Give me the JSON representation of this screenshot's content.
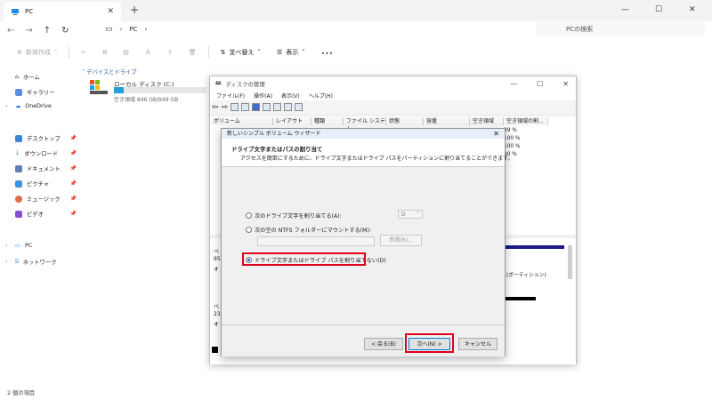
{
  "window": {
    "tab_title": "PC",
    "new_tab": "+",
    "minimize": "—",
    "maximize": "☐",
    "close": "✕"
  },
  "address": {
    "root": "PC",
    "placeholder": "PCの検索"
  },
  "toolbar": {
    "new_label": "新規作成",
    "sort_label": "並べ替え",
    "view_label": "表示",
    "more_label": "･･･"
  },
  "sidebar": {
    "home": "ホーム",
    "gallery": "ギャラリー",
    "onedrive": "OneDrive",
    "desktop": "デスクトップ",
    "downloads": "ダウンロード",
    "documents": "ドキュメント",
    "pictures": "ピクチャ",
    "music": "ミュージック",
    "videos": "ビデオ",
    "pc": "PC",
    "network": "ネットワーク"
  },
  "main": {
    "group": "デバイスとドライブ",
    "drive_name": "ローカル ディスク (C:)",
    "drive_free": "空き領域 846 GB/949 GB",
    "drive_used_fraction": 0.11
  },
  "status_bar": "2 個の項目",
  "disk_mgmt": {
    "title": "ディスクの管理",
    "menu": [
      "ファイル(F)",
      "操作(A)",
      "表示(V)",
      "ヘルプ(H)"
    ],
    "columns": [
      "ボリューム",
      "レイアウト",
      "種類",
      "ファイル システム",
      "状態",
      "容量",
      "空き領域",
      "空き領域の割..."
    ],
    "pcts": [
      "89 %",
      "100 %",
      "100 %",
      "90 %"
    ],
    "lower_labels": [
      "ベ",
      "95",
      "オ",
      "ベ",
      "23",
      "オ"
    ],
    "partition_text": "(ボーティション)"
  },
  "wizard": {
    "title": "新しいシンプル ボリューム ウィザード",
    "heading": "ドライブ文字またはパスの割り当て",
    "subheading": "アクセスを簡単にするために、ドライブ文字またはドライブ パスをパーティションに割り当てることができます。",
    "opt1": "次のドライブ文字を割り当てる(A):",
    "drive_letter": "D",
    "opt2": "次の空の NTFS フォルダーにマウントする(M):",
    "browse": "参照(R)...",
    "opt3": "ドライブ文字またはドライブ パスを割り当てない(D)",
    "back": "< 戻る(B)",
    "next": "次へ(N) >",
    "cancel": "キャンセル"
  }
}
